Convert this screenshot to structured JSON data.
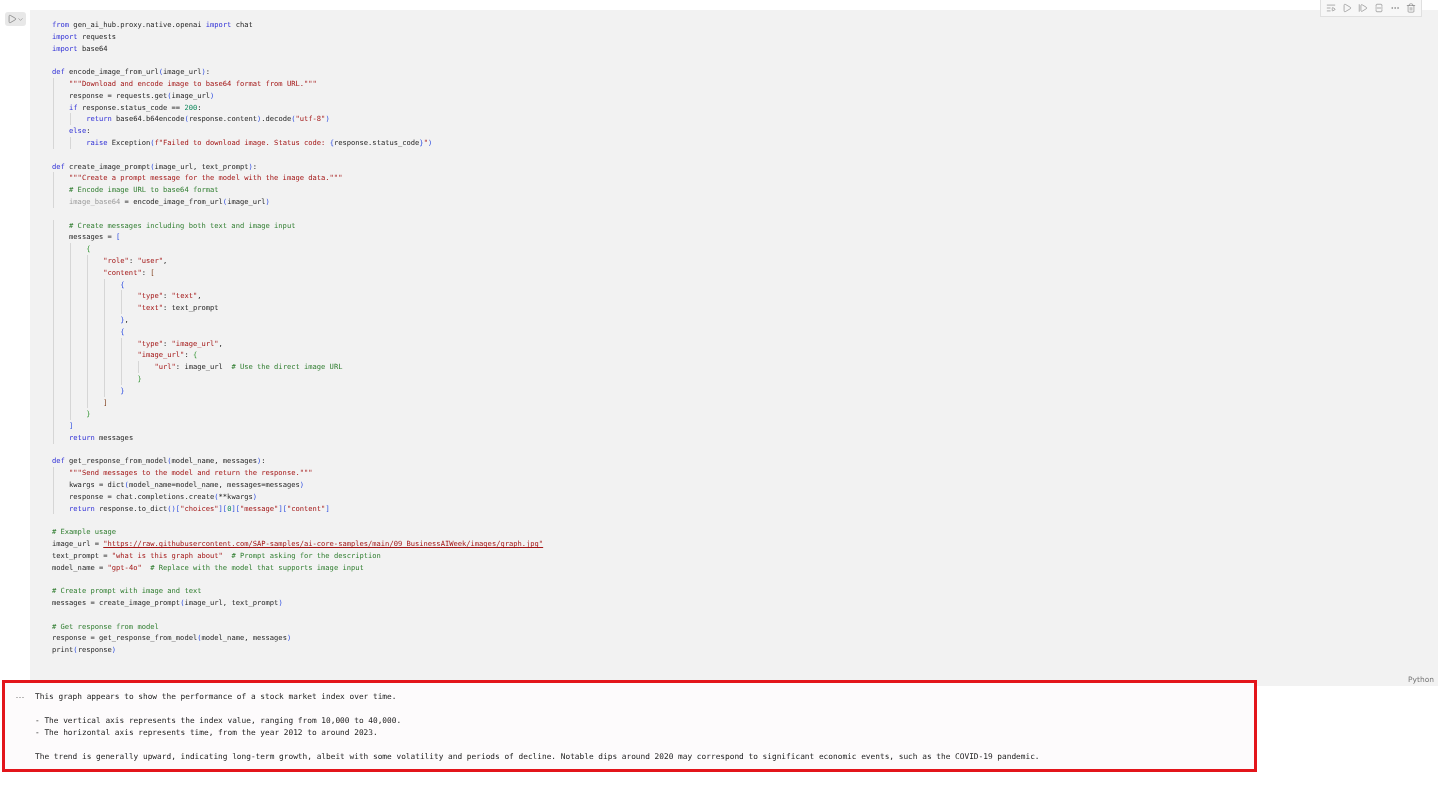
{
  "cell": {
    "code_blocks": [
      {
        "lines": [
          {
            "tokens": [
              {
                "kind": "keyword",
                "text": "from"
              },
              {
                "kind": "plain",
                "text": " gen_ai_hub.proxy.native.openai "
              },
              {
                "kind": "keyword",
                "text": "import"
              },
              {
                "kind": "plain",
                "text": " chat"
              }
            ]
          },
          {
            "tokens": [
              {
                "kind": "keyword",
                "text": "import"
              },
              {
                "kind": "plain",
                "text": " requests"
              }
            ]
          },
          {
            "tokens": [
              {
                "kind": "keyword",
                "text": "import"
              },
              {
                "kind": "plain",
                "text": " base64"
              }
            ]
          }
        ]
      },
      {
        "lines": [
          {
            "tokens": [
              {
                "kind": "keyword",
                "text": "def"
              },
              {
                "kind": "plain",
                "text": " encode_image_from_url"
              },
              {
                "kind": "paren1",
                "text": "("
              },
              {
                "kind": "plain",
                "text": "image_url"
              },
              {
                "kind": "paren1",
                "text": ")"
              },
              {
                "kind": "plain",
                "text": ":"
              }
            ]
          },
          {
            "tokens": [
              {
                "kind": "string",
                "text": "    \"\"\"Download and encode image to base64 format from URL.\"\"\""
              }
            ]
          },
          {
            "tokens": [
              {
                "kind": "plain",
                "text": "    response = requests.get"
              },
              {
                "kind": "paren1",
                "text": "("
              },
              {
                "kind": "plain",
                "text": "image_url"
              },
              {
                "kind": "paren1",
                "text": ")"
              }
            ]
          },
          {
            "tokens": [
              {
                "kind": "keyword",
                "text": "    if"
              },
              {
                "kind": "plain",
                "text": " response.status_code == "
              },
              {
                "kind": "number",
                "text": "200"
              },
              {
                "kind": "plain",
                "text": ":"
              }
            ]
          },
          {
            "tokens": [
              {
                "kind": "keyword",
                "text": "        return"
              },
              {
                "kind": "plain",
                "text": " base64.b64encode"
              },
              {
                "kind": "paren1",
                "text": "("
              },
              {
                "kind": "plain",
                "text": "response.content"
              },
              {
                "kind": "paren1",
                "text": ")"
              },
              {
                "kind": "plain",
                "text": ".decode"
              },
              {
                "kind": "paren1",
                "text": "("
              },
              {
                "kind": "string",
                "text": "\"utf-8\""
              },
              {
                "kind": "paren1",
                "text": ")"
              }
            ]
          },
          {
            "tokens": [
              {
                "kind": "keyword",
                "text": "    else"
              },
              {
                "kind": "plain",
                "text": ":"
              }
            ]
          },
          {
            "tokens": [
              {
                "kind": "keyword",
                "text": "        raise"
              },
              {
                "kind": "plain",
                "text": " Exception"
              },
              {
                "kind": "paren1",
                "text": "("
              },
              {
                "kind": "string",
                "text": "f\"Failed to download image. Status code: "
              },
              {
                "kind": "paren1",
                "text": "{"
              },
              {
                "kind": "plain",
                "text": "response.status_code"
              },
              {
                "kind": "paren1",
                "text": "}"
              },
              {
                "kind": "string",
                "text": "\""
              },
              {
                "kind": "paren1",
                "text": ")"
              }
            ]
          }
        ]
      },
      {
        "lines": [
          {
            "tokens": [
              {
                "kind": "keyword",
                "text": "def"
              },
              {
                "kind": "plain",
                "text": " create_image_prompt"
              },
              {
                "kind": "paren1",
                "text": "("
              },
              {
                "kind": "plain",
                "text": "image_url, text_prompt"
              },
              {
                "kind": "paren1",
                "text": ")"
              },
              {
                "kind": "plain",
                "text": ":"
              }
            ]
          },
          {
            "tokens": [
              {
                "kind": "string",
                "text": "    \"\"\"Create a prompt message for the model with the image data.\"\"\""
              }
            ]
          },
          {
            "tokens": [
              {
                "kind": "comment",
                "text": "    # Encode image URL to base64 format"
              }
            ]
          },
          {
            "tokens": [
              {
                "kind": "unused",
                "text": "    image_base64"
              },
              {
                "kind": "plain",
                "text": " = encode_image_from_url"
              },
              {
                "kind": "paren1",
                "text": "("
              },
              {
                "kind": "plain",
                "text": "image_url"
              },
              {
                "kind": "paren1",
                "text": ")"
              }
            ]
          }
        ]
      },
      {
        "lines": [
          {
            "tokens": [
              {
                "kind": "comment",
                "text": "    # Create messages including both text and image input"
              }
            ]
          },
          {
            "tokens": [
              {
                "kind": "plain",
                "text": "    messages = "
              },
              {
                "kind": "paren1",
                "text": "["
              }
            ]
          },
          {
            "tokens": [
              {
                "kind": "paren2",
                "text": "        {"
              }
            ]
          },
          {
            "tokens": [
              {
                "kind": "string",
                "text": "            \"role\""
              },
              {
                "kind": "plain",
                "text": ": "
              },
              {
                "kind": "string",
                "text": "\"user\""
              },
              {
                "kind": "plain",
                "text": ","
              }
            ]
          },
          {
            "tokens": [
              {
                "kind": "string",
                "text": "            \"content\""
              },
              {
                "kind": "plain",
                "text": ": "
              },
              {
                "kind": "paren3",
                "text": "["
              }
            ]
          },
          {
            "tokens": [
              {
                "kind": "paren1",
                "text": "                {"
              }
            ]
          },
          {
            "tokens": [
              {
                "kind": "string",
                "text": "                    \"type\""
              },
              {
                "kind": "plain",
                "text": ": "
              },
              {
                "kind": "string",
                "text": "\"text\""
              },
              {
                "kind": "plain",
                "text": ","
              }
            ]
          },
          {
            "tokens": [
              {
                "kind": "string",
                "text": "                    \"text\""
              },
              {
                "kind": "plain",
                "text": ": text_prompt"
              }
            ]
          },
          {
            "tokens": [
              {
                "kind": "paren1",
                "text": "                }"
              },
              {
                "kind": "plain",
                "text": ","
              }
            ]
          },
          {
            "tokens": [
              {
                "kind": "paren1",
                "text": "                {"
              }
            ]
          },
          {
            "tokens": [
              {
                "kind": "string",
                "text": "                    \"type\""
              },
              {
                "kind": "plain",
                "text": ": "
              },
              {
                "kind": "string",
                "text": "\"image_url\""
              },
              {
                "kind": "plain",
                "text": ","
              }
            ]
          },
          {
            "tokens": [
              {
                "kind": "string",
                "text": "                    \"image_url\""
              },
              {
                "kind": "plain",
                "text": ": "
              },
              {
                "kind": "paren2",
                "text": "{"
              }
            ]
          },
          {
            "tokens": [
              {
                "kind": "string",
                "text": "                        \"url\""
              },
              {
                "kind": "plain",
                "text": ": image_url  "
              },
              {
                "kind": "comment",
                "text": "# Use the direct image URL"
              }
            ]
          },
          {
            "tokens": [
              {
                "kind": "paren2",
                "text": "                    }"
              }
            ]
          },
          {
            "tokens": [
              {
                "kind": "paren1",
                "text": "                }"
              }
            ]
          },
          {
            "tokens": [
              {
                "kind": "paren3",
                "text": "            ]"
              }
            ]
          },
          {
            "tokens": [
              {
                "kind": "paren2",
                "text": "        }"
              }
            ]
          },
          {
            "tokens": [
              {
                "kind": "paren1",
                "text": "    ]"
              }
            ]
          },
          {
            "tokens": [
              {
                "kind": "keyword",
                "text": "    return"
              },
              {
                "kind": "plain",
                "text": " messages"
              }
            ]
          }
        ]
      },
      {
        "lines": [
          {
            "tokens": [
              {
                "kind": "keyword",
                "text": "def"
              },
              {
                "kind": "plain",
                "text": " get_response_from_model"
              },
              {
                "kind": "paren1",
                "text": "("
              },
              {
                "kind": "plain",
                "text": "model_name, messages"
              },
              {
                "kind": "paren1",
                "text": ")"
              },
              {
                "kind": "plain",
                "text": ":"
              }
            ]
          },
          {
            "tokens": [
              {
                "kind": "string",
                "text": "    \"\"\"Send messages to the model and return the response.\"\"\""
              }
            ]
          },
          {
            "tokens": [
              {
                "kind": "plain",
                "text": "    kwargs = dict"
              },
              {
                "kind": "paren1",
                "text": "("
              },
              {
                "kind": "plain",
                "text": "model_name=model_name, messages=messages"
              },
              {
                "kind": "paren1",
                "text": ")"
              }
            ]
          },
          {
            "tokens": [
              {
                "kind": "plain",
                "text": "    response = chat.completions.create"
              },
              {
                "kind": "paren1",
                "text": "("
              },
              {
                "kind": "plain",
                "text": "**kwargs"
              },
              {
                "kind": "paren1",
                "text": ")"
              }
            ]
          },
          {
            "tokens": [
              {
                "kind": "keyword",
                "text": "    return"
              },
              {
                "kind": "plain",
                "text": " response.to_dict"
              },
              {
                "kind": "paren1",
                "text": "()["
              },
              {
                "kind": "string",
                "text": "\"choices\""
              },
              {
                "kind": "paren1",
                "text": "]["
              },
              {
                "kind": "number",
                "text": "0"
              },
              {
                "kind": "paren1",
                "text": "]["
              },
              {
                "kind": "string",
                "text": "\"message\""
              },
              {
                "kind": "paren1",
                "text": "]["
              },
              {
                "kind": "string",
                "text": "\"content\""
              },
              {
                "kind": "paren1",
                "text": "]"
              }
            ]
          }
        ]
      },
      {
        "lines": [
          {
            "tokens": [
              {
                "kind": "comment",
                "text": "# Example usage"
              }
            ]
          },
          {
            "tokens": [
              {
                "kind": "plain",
                "text": "image_url = "
              },
              {
                "kind": "link",
                "text": "\"https://raw.githubusercontent.com/SAP-samples/ai-core-samples/main/09_BusinessAIWeek/images/graph.jpg\""
              }
            ]
          },
          {
            "tokens": [
              {
                "kind": "plain",
                "text": "text_prompt = "
              },
              {
                "kind": "string",
                "text": "\"what is this graph about\""
              },
              {
                "kind": "comment",
                "text": "  # Prompt asking for the description"
              }
            ]
          },
          {
            "tokens": [
              {
                "kind": "plain",
                "text": "model_name = "
              },
              {
                "kind": "string",
                "text": "\"gpt-4o\""
              },
              {
                "kind": "comment",
                "text": "  # Replace with the model that supports image input"
              }
            ]
          }
        ]
      },
      {
        "lines": [
          {
            "tokens": [
              {
                "kind": "comment",
                "text": "# Create prompt with image and text"
              }
            ]
          },
          {
            "tokens": [
              {
                "kind": "plain",
                "text": "messages = create_image_prompt"
              },
              {
                "kind": "paren1",
                "text": "("
              },
              {
                "kind": "plain",
                "text": "image_url, text_prompt"
              },
              {
                "kind": "paren1",
                "text": ")"
              }
            ]
          }
        ]
      },
      {
        "lines": [
          {
            "tokens": [
              {
                "kind": "comment",
                "text": "# Get response from model"
              }
            ]
          },
          {
            "tokens": [
              {
                "kind": "plain",
                "text": "response = get_response_from_model"
              },
              {
                "kind": "paren1",
                "text": "("
              },
              {
                "kind": "plain",
                "text": "model_name, messages"
              },
              {
                "kind": "paren1",
                "text": ")"
              }
            ]
          },
          {
            "tokens": [
              {
                "kind": "plain",
                "text": "print"
              },
              {
                "kind": "paren1",
                "text": "("
              },
              {
                "kind": "plain",
                "text": "response"
              },
              {
                "kind": "paren1",
                "text": ")"
              }
            ]
          }
        ]
      }
    ],
    "language": "Python",
    "output": {
      "menu": "···",
      "paragraphs": [
        {
          "lines": [
            {
              "text": "This graph appears to show the performance of a stock market index over time."
            }
          ]
        },
        {
          "lines": [
            {
              "text": "- The vertical axis represents the index value, ranging from 10,000 to 40,000."
            },
            {
              "text": "- The horizontal axis represents time, from the year 2012 to around 2023."
            }
          ]
        },
        {
          "lines": [
            {
              "text": "The trend is generally upward, indicating long-term growth, albeit with some volatility and periods of decline. Notable dips around 2020 may correspond to significant economic events, such as the COVID-19 pandemic."
            }
          ]
        }
      ]
    }
  }
}
